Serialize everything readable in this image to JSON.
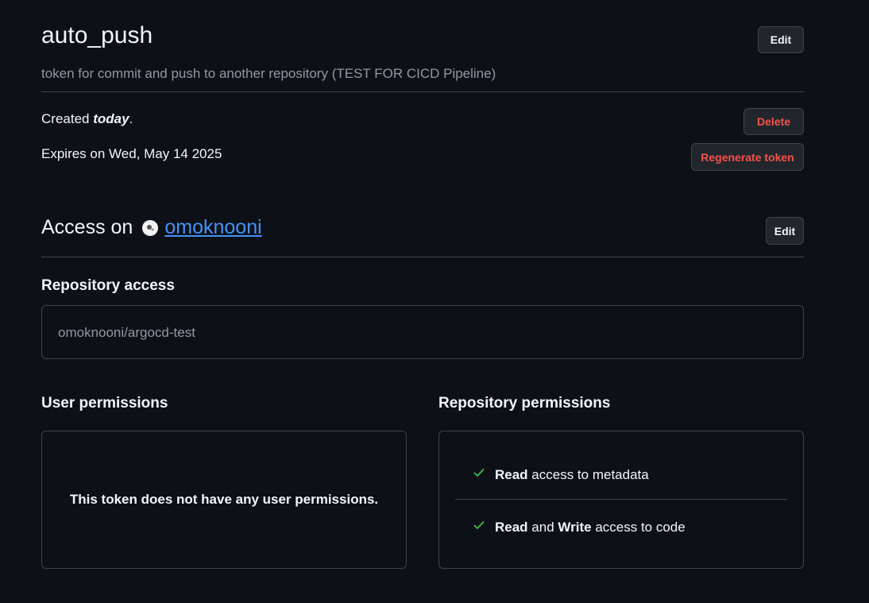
{
  "token": {
    "name": "auto_push",
    "description": "token for commit and push to another repository (TEST FOR CICD Pipeline)",
    "edit_label": "Edit",
    "created_prefix": "Created ",
    "created_value": "today",
    "created_suffix": ".",
    "expires": "Expires on Wed, May 14 2025",
    "delete_label": "Delete",
    "regenerate_label": "Regenerate token"
  },
  "access": {
    "prefix": "Access on",
    "owner": "omoknooni",
    "edit_label": "Edit"
  },
  "repository_access": {
    "heading": "Repository access",
    "repo": "omoknooni/argocd-test"
  },
  "user_permissions": {
    "heading": "User permissions",
    "empty_message": "This token does not have any user permissions."
  },
  "repository_permissions": {
    "heading": "Repository permissions",
    "items": [
      {
        "strong1": "Read",
        "mid": "",
        "strong2": "",
        "rest": " access to metadata"
      },
      {
        "strong1": "Read",
        "mid": " and ",
        "strong2": "Write",
        "rest": " access to code"
      }
    ]
  },
  "colors": {
    "background": "#0d1117",
    "link": "#4493f8",
    "danger": "#f85149",
    "success": "#3fb950"
  }
}
